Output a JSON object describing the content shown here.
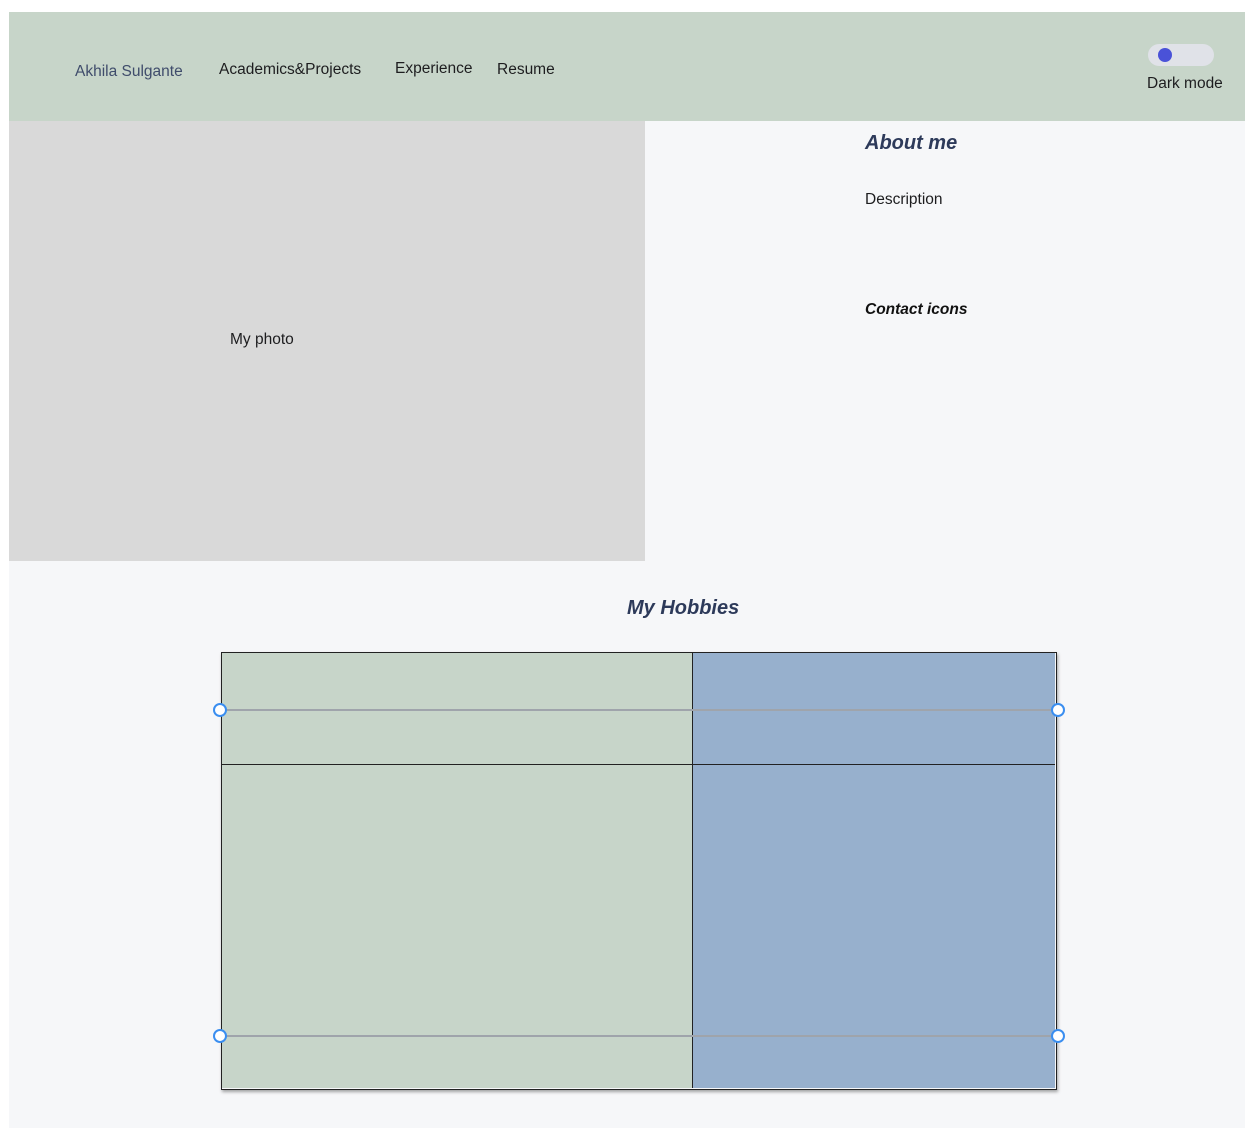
{
  "nav": {
    "brand": "Akhila Sulgante",
    "links": [
      "Academics&Projects",
      "Experience",
      "Resume"
    ],
    "toggle_label": "Dark mode",
    "toggle_on": false
  },
  "photo": {
    "label": "My photo"
  },
  "about": {
    "heading": "About me",
    "description": "Description",
    "contact_heading": "Contact icons"
  },
  "hobbies": {
    "heading": "My Hobbies",
    "grid_colors": {
      "left": "#c7d5c9",
      "right": "#97b0cd"
    }
  },
  "colors": {
    "navbar": "#c7d5c9",
    "photo_placeholder": "#d9d9d9",
    "heading": "#2d3a5a",
    "toggle_knob": "#4a52d8",
    "selection_handle": "#3a8ef0"
  }
}
